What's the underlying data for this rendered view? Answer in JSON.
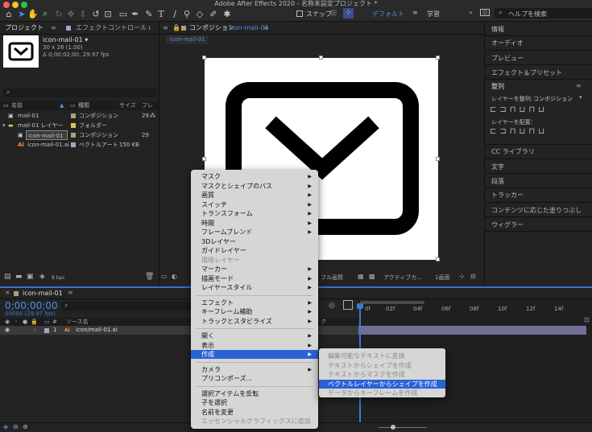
{
  "window": {
    "title": "Adobe After Effects 2020 - 名称未設定プロジェクト *"
  },
  "toolbar": {
    "snap_label": "スナップ",
    "workspace_default": "デフォルト",
    "workspace_learn": "学習",
    "search_placeholder": "ヘルプを検索"
  },
  "project_panel": {
    "tab_project": "プロジェクト",
    "tab_effects": "エフェクトコントロール ι",
    "item_name": "icon-mail-01 ▾",
    "item_size": "30 x 26 (1.00)",
    "item_duration": "Δ 0;00;02;00, 29.97 fps",
    "search_placeholder": "",
    "columns": {
      "name": "名前",
      "type": "種類",
      "size": "サイズ",
      "frame": "フレ"
    },
    "rows": [
      {
        "name": "mail-01",
        "type": "コンポジション",
        "size": "",
        "frame": "29",
        "color": "#a9a27a"
      },
      {
        "name": "mail-01 レイヤー",
        "type": "フォルダー",
        "size": "",
        "frame": "",
        "color": "#d9c25a"
      },
      {
        "name": "icon-mail-01",
        "type": "コンポジション",
        "size": "",
        "frame": "29",
        "color": "#a9a27a"
      },
      {
        "name": "icon-mail-01.ai",
        "type": "ベクトルアート",
        "size": "150 KB",
        "frame": "",
        "color": "#a9a3c9"
      }
    ],
    "bpc": "8 bpc"
  },
  "composition": {
    "tab_label": "コンポジション",
    "tab_name": "icon-mail-01",
    "subtab": "icon-mail-01",
    "quality": "フル画質",
    "camera": "アクティブカ...",
    "views": "1画面"
  },
  "timeline": {
    "tab_name": "icon-mail-01",
    "timecode": "0;00;00;00",
    "fps_label": "00000 (29.97 fps)",
    "search_placeholder": "",
    "source_header": "ソース名",
    "parent_header": "ク",
    "layer_index": "1",
    "layer_name": "icon/mail-01.ai",
    "ruler": [
      "0f",
      "02f",
      "04f",
      "06f",
      "08f",
      "10f",
      "12f",
      "14f"
    ]
  },
  "right_panel": {
    "items": [
      "情報",
      "オーディオ",
      "プレビュー",
      "エフェクト＆プリセット"
    ],
    "align_title": "整列",
    "align_to_label": "レイヤーを整列:",
    "align_to_value": "コンポジション",
    "distribute_label": "レイヤーを配置：",
    "items2": [
      "CC ライブラリ",
      "文字",
      "段落",
      "トラッカー",
      "コンテンツに応じた塗りつぶし",
      "ウィグラー"
    ]
  },
  "context_menu": {
    "groups": [
      [
        {
          "label": "マスク",
          "sub": true,
          "disabled": false
        },
        {
          "label": "マスクとシェイプのパス",
          "sub": true,
          "disabled": false
        },
        {
          "label": "画質",
          "sub": true,
          "disabled": false
        },
        {
          "label": "スイッチ",
          "sub": true,
          "disabled": false
        },
        {
          "label": "トランスフォーム",
          "sub": true,
          "disabled": false
        },
        {
          "label": "時間",
          "sub": true,
          "disabled": false
        },
        {
          "label": "フレームブレンド",
          "sub": true,
          "disabled": false
        },
        {
          "label": "3Dレイヤー",
          "sub": false,
          "disabled": false
        },
        {
          "label": "ガイドレイヤー",
          "sub": false,
          "disabled": false
        },
        {
          "label": "環境レイヤー",
          "sub": false,
          "disabled": true
        },
        {
          "label": "マーカー",
          "sub": true,
          "disabled": false
        },
        {
          "label": "描画モード",
          "sub": true,
          "disabled": false
        },
        {
          "label": "レイヤースタイル",
          "sub": true,
          "disabled": false
        }
      ],
      [
        {
          "label": "エフェクト",
          "sub": true,
          "disabled": false
        },
        {
          "label": "キーフレーム補助",
          "sub": true,
          "disabled": false
        },
        {
          "label": "トラックとスタビライズ",
          "sub": true,
          "disabled": false
        }
      ],
      [
        {
          "label": "開く",
          "sub": true,
          "disabled": false
        },
        {
          "label": "表示",
          "sub": true,
          "disabled": false
        },
        {
          "label": "作成",
          "sub": true,
          "disabled": false,
          "highlight": true
        }
      ],
      [
        {
          "label": "カメラ",
          "sub": true,
          "disabled": false
        },
        {
          "label": "プリコンポーズ...",
          "sub": false,
          "disabled": false
        }
      ],
      [
        {
          "label": "選択アイテムを反転",
          "sub": false,
          "disabled": false
        },
        {
          "label": "子を選択",
          "sub": false,
          "disabled": false
        },
        {
          "label": "名前を変更",
          "sub": false,
          "disabled": false
        },
        {
          "label": "エッセンシャルグラフィックスに追加",
          "sub": false,
          "disabled": true
        }
      ]
    ]
  },
  "submenu": {
    "items": [
      {
        "label": "編集可能なテキストに変換",
        "disabled": true
      },
      {
        "label": "テキストからシェイプを作成",
        "disabled": true
      },
      {
        "label": "テキストからマスクを作成",
        "disabled": true
      },
      {
        "label": "ベクトルレイヤーからシェイプを作成",
        "disabled": false,
        "highlight": true
      },
      {
        "label": "データからキーフレームを作成",
        "disabled": true
      }
    ]
  },
  "colors": {
    "accent": "#2a62d6",
    "timecode": "#4d8fe6",
    "cti": "#3a7ad8",
    "layer_bar": "#6f6f96"
  }
}
